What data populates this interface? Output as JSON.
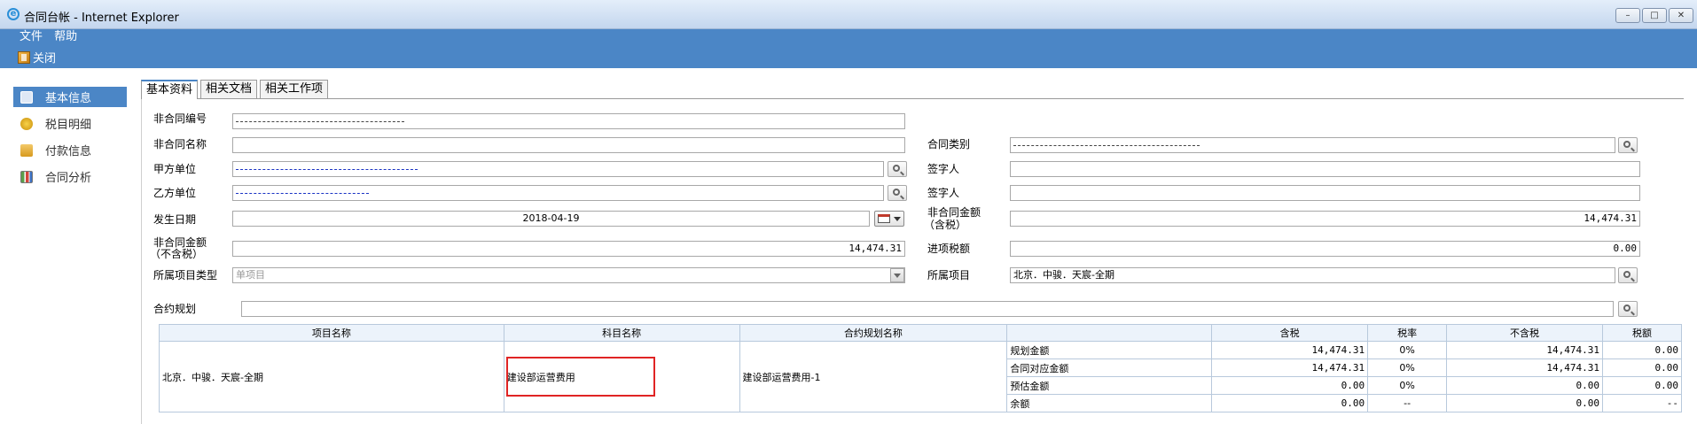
{
  "window": {
    "title": "合同台帐 - Internet Explorer"
  },
  "menu": {
    "items": [
      "文件",
      "帮助"
    ]
  },
  "toolbar": {
    "close_label": "关闭"
  },
  "sidebar": {
    "items": [
      {
        "label": "基本信息",
        "icon": "document-icon",
        "active": true
      },
      {
        "label": "税目明细",
        "icon": "coins-icon"
      },
      {
        "label": "付款信息",
        "icon": "payment-icon"
      },
      {
        "label": "合同分析",
        "icon": "analysis-icon"
      }
    ]
  },
  "tabs": [
    "基本资料",
    "相关文档",
    "相关工作项"
  ],
  "form": {
    "contract_no_label": "非合同编号",
    "contract_no_value": "",
    "contract_name_label": "非合同名称",
    "contract_name_value": "",
    "contract_type_label": "合同类别",
    "contract_type_value": "",
    "party_a_label": "甲方单位",
    "party_a_value": "",
    "signer_a_label": "签字人",
    "signer_a_value": "",
    "party_b_label": "乙方单位",
    "party_b_value": "",
    "signer_b_label": "签字人",
    "signer_b_value": "",
    "date_label": "发生日期",
    "date_value": "2018-04-19",
    "amount_tax_label_1": "非合同金额",
    "amount_tax_label_2": "（含税）",
    "amount_tax_value": "14,474.31",
    "amount_notax_label_1": "非合同金额",
    "amount_notax_label_2": "（不含税）",
    "amount_notax_value": "14,474.31",
    "input_tax_label": "进项税额",
    "input_tax_value": "0.00",
    "project_type_label": "所属项目类型",
    "project_type_placeholder": "单项目",
    "project_label": "所属项目",
    "project_value": "北京．中骏．天宸-全期",
    "plan_label": "合约规划",
    "plan_value": ""
  },
  "grid": {
    "headers": [
      "项目名称",
      "科目名称",
      "合约规划名称",
      "",
      "含税",
      "税率",
      "不含税",
      "税额"
    ],
    "project": "北京．中骏．天宸-全期",
    "subject": "建设部运营费用",
    "plan_name": "建设部运营费用-1",
    "rows": [
      {
        "label": "规划金额",
        "tax_incl": "14,474.31",
        "rate": "0%",
        "tax_excl": "14,474.31",
        "tax": "0.00"
      },
      {
        "label": "合同对应金额",
        "tax_incl": "14,474.31",
        "rate": "0%",
        "tax_excl": "14,474.31",
        "tax": "0.00"
      },
      {
        "label": "预估金额",
        "tax_incl": "0.00",
        "rate": "0%",
        "tax_excl": "0.00",
        "tax": "0.00"
      },
      {
        "label": "余额",
        "tax_incl": "0.00",
        "rate": "--",
        "tax_excl": "0.00",
        "tax": "--"
      }
    ]
  },
  "colors": {
    "accent": "#4b86c6",
    "highlight": "#e02424"
  }
}
